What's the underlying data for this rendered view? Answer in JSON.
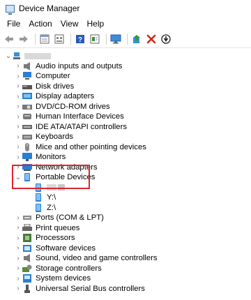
{
  "window": {
    "title": "Device Manager"
  },
  "menu": [
    "File",
    "Action",
    "View",
    "Help"
  ],
  "toolbar": {
    "buttons": [
      "back-arrow-icon",
      "forward-arrow-icon",
      "properties-icon",
      "show-hidden-icon",
      "help-icon",
      "details-icon",
      "monitor-icon",
      "update-driver-icon",
      "uninstall-icon",
      "disable-device-icon"
    ]
  },
  "tree": {
    "root": {
      "label": ""
    },
    "categories": [
      {
        "label": "Audio inputs and outputs",
        "icon": "speaker-icon",
        "color": "#7a7a7a"
      },
      {
        "label": "Computer",
        "icon": "computer-icon",
        "color": "#2a7fd4"
      },
      {
        "label": "Disk drives",
        "icon": "disk-drive-icon",
        "color": "#555555"
      },
      {
        "label": "Display adapters",
        "icon": "display-adapter-icon",
        "color": "#2a7fd4"
      },
      {
        "label": "DVD/CD-ROM drives",
        "icon": "dvd-drive-icon",
        "color": "#777777"
      },
      {
        "label": "Human Interface Devices",
        "icon": "hid-icon",
        "color": "#777777"
      },
      {
        "label": "IDE ATA/ATAPI controllers",
        "icon": "ide-controller-icon",
        "color": "#6a6a6a"
      },
      {
        "label": "Keyboards",
        "icon": "keyboard-icon",
        "color": "#777777"
      },
      {
        "label": "Mice and other pointing devices",
        "icon": "mouse-icon",
        "color": "#888888"
      },
      {
        "label": "Monitors",
        "icon": "monitor-icon",
        "color": "#2a7fd4"
      },
      {
        "label": "Network adapters",
        "icon": "network-adapter-icon",
        "color": "#2a7fd4"
      }
    ],
    "portable": {
      "label": "Portable Devices",
      "children": [
        {
          "label": "",
          "icon": "portable-device-icon"
        },
        {
          "label": "Y:\\",
          "icon": "portable-device-icon"
        },
        {
          "label": "Z:\\",
          "icon": "portable-device-icon"
        }
      ]
    },
    "categories_after": [
      {
        "label": "Ports (COM & LPT)",
        "icon": "port-icon",
        "color": "#888888"
      },
      {
        "label": "Print queues",
        "icon": "printer-icon",
        "color": "#666666"
      },
      {
        "label": "Processors",
        "icon": "processor-icon",
        "color": "#4a7a3a"
      },
      {
        "label": "Software devices",
        "icon": "software-device-icon",
        "color": "#2a7fd4"
      },
      {
        "label": "Sound, video and game controllers",
        "icon": "sound-icon",
        "color": "#7a7a7a"
      },
      {
        "label": "Storage controllers",
        "icon": "storage-controller-icon",
        "color": "#5a8a3a"
      },
      {
        "label": "System devices",
        "icon": "system-device-icon",
        "color": "#2a7fd4"
      },
      {
        "label": "Universal Serial Bus controllers",
        "icon": "usb-icon",
        "color": "#555555"
      }
    ]
  },
  "accent": "#e0242f"
}
